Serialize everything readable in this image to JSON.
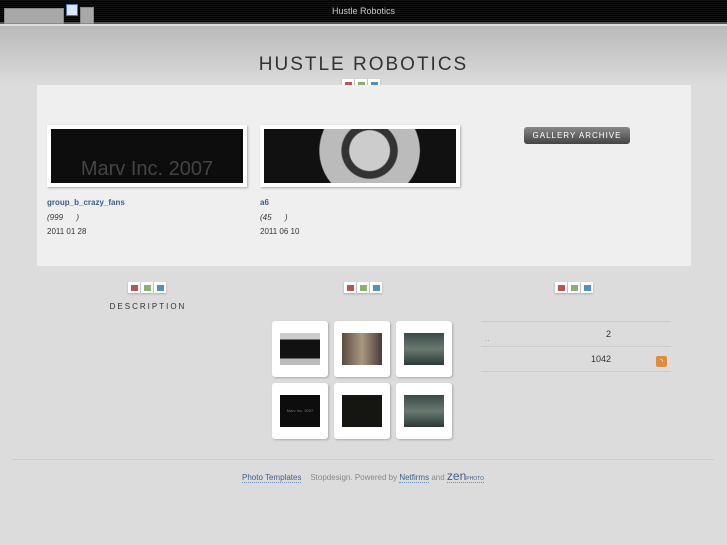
{
  "window": {
    "title": "Hustle Robotics"
  },
  "header": {
    "site_title": "HUSTLE ROBOTICS"
  },
  "colors": {
    "red": "#b85555",
    "green": "#88b070",
    "blue": "#5090c0"
  },
  "albums": [
    {
      "name": "group_b_crazy_fans",
      "count": "(999      )",
      "date": "2011 01 28",
      "thumb_text": "Marv Inc. 2007"
    },
    {
      "name": "a6",
      "count": "(45      )",
      "date": "2011 06 10"
    }
  ],
  "gallery_archive_label": "GALLERY ARCHIVE",
  "description_label": "DESCRIPTION",
  "images": [
    {
      "thumb": "car-rear"
    },
    {
      "thumb": "crowd"
    },
    {
      "thumb": "truck"
    },
    {
      "thumb": "marv-logo",
      "text": "Marv Inc. 2007"
    },
    {
      "thumb": "dark"
    },
    {
      "thumb": "truck"
    }
  ],
  "stats": [
    {
      "label": "..",
      "value": "2"
    },
    {
      "label": "",
      "value": "1042",
      "icon": "rss-icon"
    }
  ],
  "footer": {
    "photo_templates": "Photo Templates",
    "middle": "Stopdesign. Powered by",
    "netfirms": "Netfirms",
    "and": "and",
    "zen": "zen",
    "photo": "PHOTO"
  }
}
